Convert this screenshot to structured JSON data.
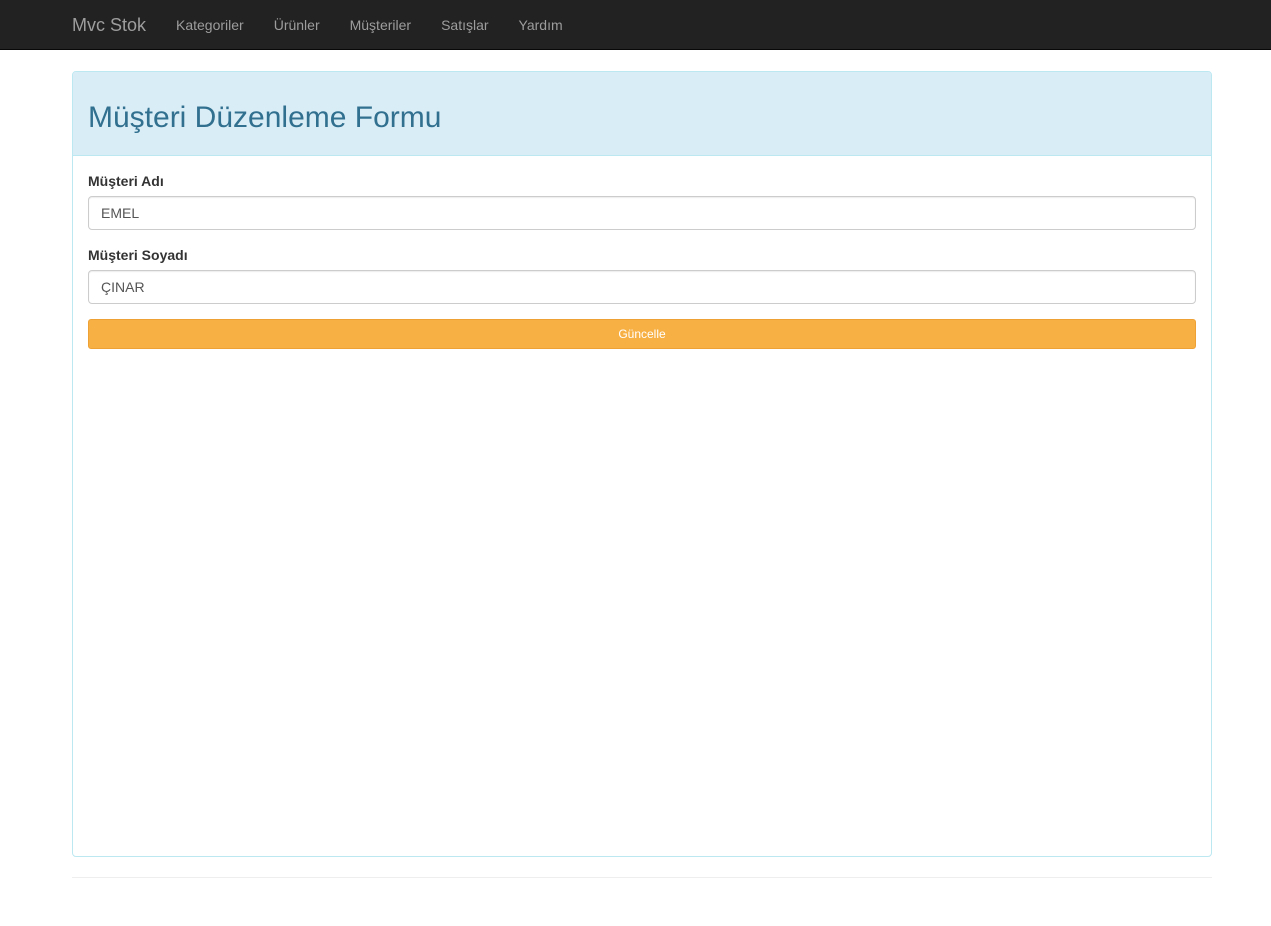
{
  "navbar": {
    "brand": "Mvc Stok",
    "items": [
      {
        "label": "Kategoriler"
      },
      {
        "label": "Ürünler"
      },
      {
        "label": "Müşteriler"
      },
      {
        "label": "Satışlar"
      },
      {
        "label": "Yardım"
      }
    ]
  },
  "panel": {
    "title": "Müşteri Düzenleme Formu"
  },
  "form": {
    "first_name_label": "Müşteri Adı",
    "first_name_value": "EMEL",
    "last_name_label": "Müşteri Soyadı",
    "last_name_value": "ÇINAR",
    "submit_label": "Güncelle"
  },
  "colors": {
    "navbar_bg": "#222222",
    "panel_heading_bg": "#d9edf7",
    "panel_title": "#31708f",
    "button_warning": "#f7b044"
  }
}
